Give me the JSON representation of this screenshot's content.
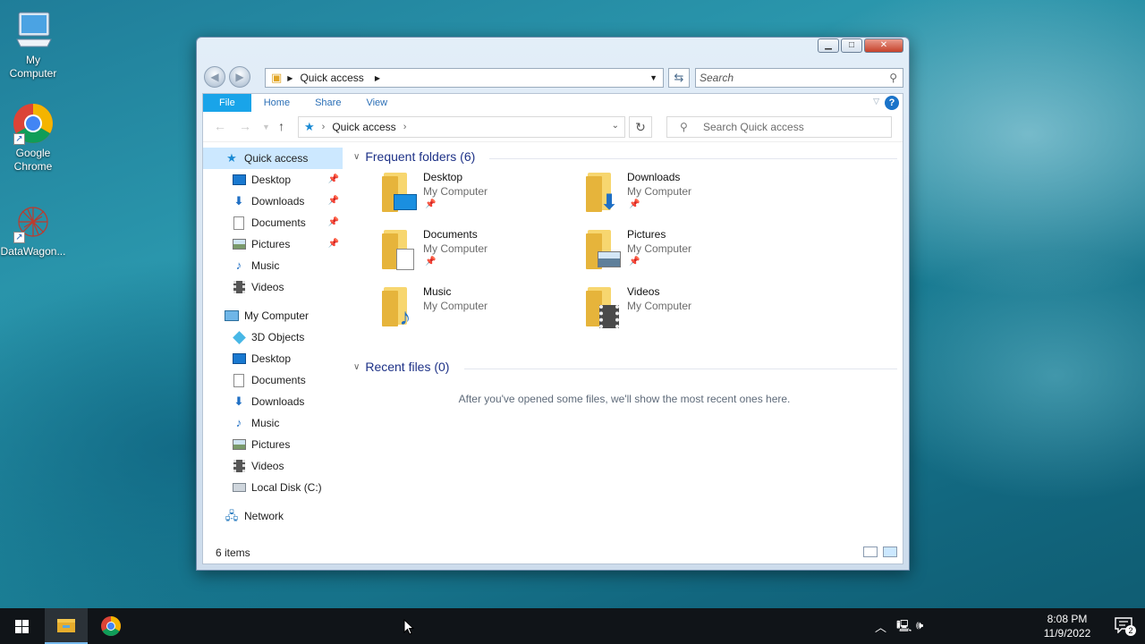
{
  "desktop": {
    "icons": [
      {
        "label": "My\nComputer",
        "icon": "computer-icon"
      },
      {
        "label": "Google\nChrome",
        "icon": "chrome-icon"
      },
      {
        "label": "DataWagon...",
        "icon": "datawagon-icon"
      }
    ],
    "icon_labels": {
      "my_computer_1": "My",
      "my_computer_2": "Computer",
      "chrome_1": "Google",
      "chrome_2": "Chrome",
      "datawagon": "DataWagon..."
    }
  },
  "window": {
    "title_buttons": {
      "minimize": "▁",
      "maximize": "□",
      "close": "✕"
    },
    "legacy_address": "Quick access",
    "legacy_search_placeholder": "Search",
    "ribbon": {
      "tabs": [
        "File",
        "Home",
        "Share",
        "View"
      ],
      "help": "?"
    },
    "address": {
      "crumb": "Quick access",
      "search_placeholder": "Search Quick access"
    },
    "nav": {
      "quick_access": "Quick access",
      "quick_items": [
        {
          "label": "Desktop",
          "pinned": true
        },
        {
          "label": "Downloads",
          "pinned": true
        },
        {
          "label": "Documents",
          "pinned": true
        },
        {
          "label": "Pictures",
          "pinned": true
        },
        {
          "label": "Music",
          "pinned": false
        },
        {
          "label": "Videos",
          "pinned": false
        }
      ],
      "my_computer": "My Computer",
      "computer_items": [
        "3D Objects",
        "Desktop",
        "Documents",
        "Downloads",
        "Music",
        "Pictures",
        "Videos",
        "Local Disk (C:)"
      ],
      "network": "Network"
    },
    "main": {
      "frequent_header": "Frequent folders (6)",
      "folders": [
        {
          "name": "Desktop",
          "location": "My Computer",
          "pinned": true
        },
        {
          "name": "Downloads",
          "location": "My Computer",
          "pinned": true
        },
        {
          "name": "Documents",
          "location": "My Computer",
          "pinned": true
        },
        {
          "name": "Pictures",
          "location": "My Computer",
          "pinned": true
        },
        {
          "name": "Music",
          "location": "My Computer",
          "pinned": false
        },
        {
          "name": "Videos",
          "location": "My Computer",
          "pinned": false
        }
      ],
      "recent_header": "Recent files (0)",
      "recent_empty": "After you've opened some files, we'll show the most recent ones here."
    },
    "status": {
      "items": "6 items"
    }
  },
  "taskbar": {
    "apps": [
      "file-explorer",
      "google-chrome"
    ],
    "clock_time": "8:08 PM",
    "clock_date": "11/9/2022",
    "notifications": "2"
  }
}
